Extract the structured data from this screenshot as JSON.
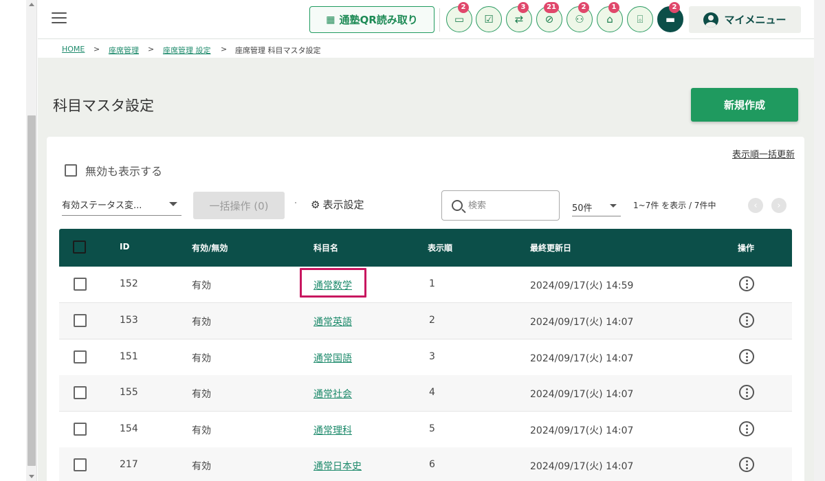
{
  "header": {
    "qr_label": "通塾QR読み取り",
    "icons": [
      {
        "name": "message-icon",
        "badge": "2",
        "glyph": "▭"
      },
      {
        "name": "checklist-icon",
        "badge": "",
        "glyph": "☑"
      },
      {
        "name": "transfer-icon",
        "badge": "3",
        "glyph": "⇄"
      },
      {
        "name": "no-attendance-icon",
        "badge": "21",
        "glyph": "⊘"
      },
      {
        "name": "group-icon",
        "badge": "2",
        "glyph": "⚇"
      },
      {
        "name": "school-icon",
        "badge": "1",
        "glyph": "⌂"
      },
      {
        "name": "gift-icon",
        "badge": "",
        "glyph": "⌺"
      },
      {
        "name": "chat-icon",
        "badge": "2",
        "glyph": "▬"
      }
    ],
    "mymenu_label": "マイメニュー"
  },
  "breadcrumb": {
    "items": [
      "HOME",
      "座席管理",
      "座席管理 設定",
      "座席管理 科目マスタ設定"
    ],
    "separator": ">"
  },
  "page": {
    "title": "科目マスタ設定",
    "new_button": "新規作成"
  },
  "toolbar": {
    "bulk_order_link": "表示順一括更新",
    "show_invalid_label": "無効も表示する",
    "status_select_value": "有効ステータス変...",
    "bulk_action_label": "一括操作 (0)",
    "display_settings_label": "表示設定",
    "search_placeholder": "検索",
    "per_page_value": "50件",
    "count_text": "1~7件 を表示 / 7件中"
  },
  "table": {
    "headers": [
      "ID",
      "有効/無効",
      "科目名",
      "表示順",
      "最終更新日",
      "操作"
    ],
    "rows": [
      {
        "id": "152",
        "status": "有効",
        "name": "通常数学",
        "order": "1",
        "updated": "2024/09/17(火) 14:59"
      },
      {
        "id": "153",
        "status": "有効",
        "name": "通常英語",
        "order": "2",
        "updated": "2024/09/17(火) 14:07"
      },
      {
        "id": "151",
        "status": "有効",
        "name": "通常国語",
        "order": "3",
        "updated": "2024/09/17(火) 14:07"
      },
      {
        "id": "155",
        "status": "有効",
        "name": "通常社会",
        "order": "4",
        "updated": "2024/09/17(火) 14:07"
      },
      {
        "id": "154",
        "status": "有効",
        "name": "通常理科",
        "order": "5",
        "updated": "2024/09/17(火) 14:07"
      },
      {
        "id": "217",
        "status": "有効",
        "name": "通常日本史",
        "order": "6",
        "updated": "2024/09/17(火) 14:07"
      }
    ]
  },
  "colors": {
    "primary_green": "#1f9a5f",
    "table_header": "#0c4f49",
    "badge": "#e0476b",
    "highlight": "#c8165f",
    "link": "#1d8a6b"
  }
}
